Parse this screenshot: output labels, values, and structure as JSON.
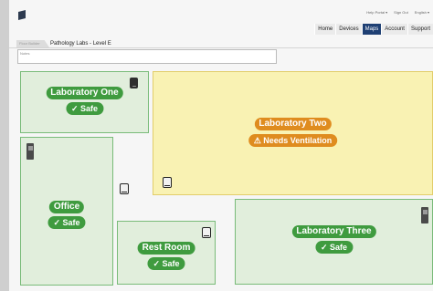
{
  "header": {
    "links": [
      "Help Portal ▾",
      "Sign Out",
      "English ▾"
    ],
    "nav": [
      {
        "label": "Home",
        "active": false
      },
      {
        "label": "Devices",
        "active": false
      },
      {
        "label": "Maps",
        "active": true
      },
      {
        "label": "Account",
        "active": false
      },
      {
        "label": "Support",
        "active": false
      }
    ]
  },
  "tabs": {
    "back_label": "Floor Builder",
    "title": "Pathology Labs - Level E"
  },
  "notes": {
    "placeholder": "Notes"
  },
  "rooms": {
    "lab_one": {
      "name": "Laboratory One",
      "status": "✓ Safe"
    },
    "lab_two": {
      "name": "Laboratory Two",
      "status": "⚠ Needs Ventilation"
    },
    "office": {
      "name": "Office",
      "status": "✓ Safe"
    },
    "rest_room": {
      "name": "Rest Room",
      "status": "✓ Safe"
    },
    "lab_three": {
      "name": "Laboratory Three",
      "status": "✓ Safe"
    }
  },
  "colors": {
    "safe": "#3f9b3f",
    "warning": "#df8c1f",
    "nav_active": "#1e3f73"
  }
}
